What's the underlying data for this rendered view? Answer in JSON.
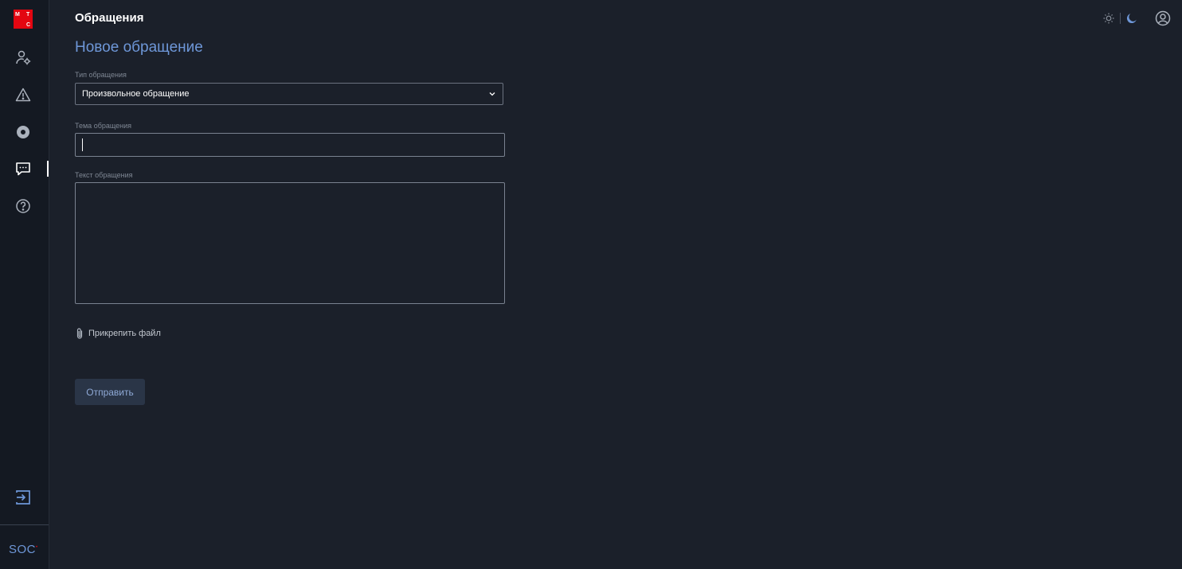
{
  "app": {
    "brand_letters": [
      "М",
      "Т",
      "С"
    ],
    "brand_color": "#e30611",
    "soc_label": "SOC"
  },
  "sidebar": {
    "items": [
      {
        "name": "users-settings",
        "icon": "user-gear-icon",
        "active": false
      },
      {
        "name": "incidents",
        "icon": "warning-triangle-icon",
        "active": false
      },
      {
        "name": "monitoring",
        "icon": "target-circle-icon",
        "active": false
      },
      {
        "name": "requests",
        "icon": "chat-bubble-icon",
        "active": true
      },
      {
        "name": "help",
        "icon": "question-circle-icon",
        "active": false
      }
    ],
    "logout_icon": "logout-icon"
  },
  "header": {
    "title": "Обращения",
    "theme_options": [
      "sun-icon",
      "moon-icon"
    ],
    "theme_selected": "dark",
    "profile_icon": "user-circle-icon"
  },
  "form": {
    "heading": "Новое обращение",
    "type_label": "Тип обращения",
    "type_value": "Произвольное обращение",
    "subject_label": "Тема обращения",
    "subject_value": "",
    "text_label": "Текст обращения",
    "text_value": "",
    "attach_label": "Прикрепить файл",
    "submit_label": "Отправить"
  },
  "colors": {
    "background": "#1b202a",
    "sidebar": "#141922",
    "accent": "#6e97d8",
    "button_bg": "#2a3547"
  }
}
